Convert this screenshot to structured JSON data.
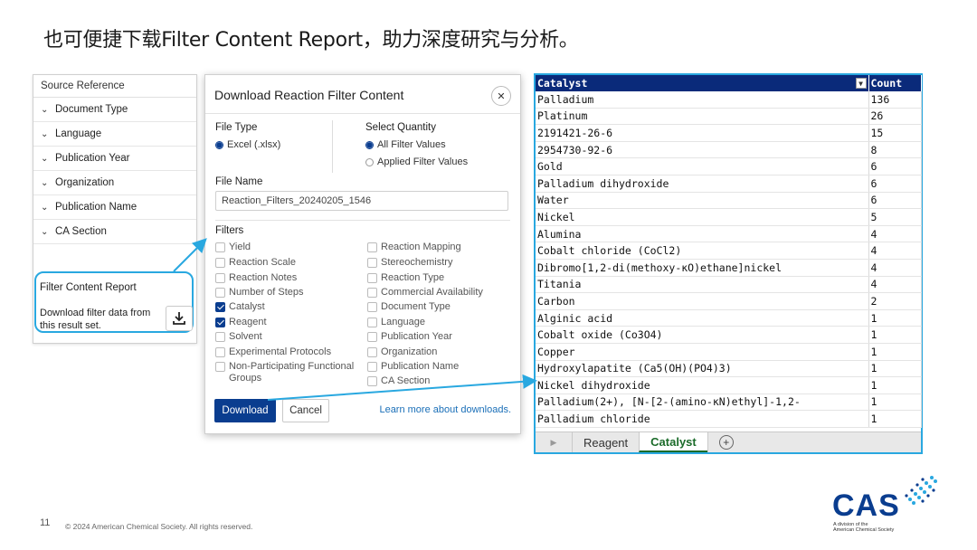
{
  "slide": {
    "title": "也可便捷下载Filter Content Report，助力深度研究与分析。",
    "page_number": "11",
    "copyright": "© 2024 American Chemical Society. All rights reserved.",
    "logo_text": "CAS",
    "logo_sub_1": "A division of the",
    "logo_sub_2": "American Chemical Society"
  },
  "sidebar": {
    "header": "Source Reference",
    "items": [
      {
        "label": "Document Type"
      },
      {
        "label": "Language"
      },
      {
        "label": "Publication Year"
      },
      {
        "label": "Organization"
      },
      {
        "label": "Publication Name"
      },
      {
        "label": "CA Section"
      }
    ],
    "report_title": "Filter Content Report",
    "report_desc": "Download filter data from this result set."
  },
  "dialog": {
    "title": "Download Reaction Filter Content",
    "file_type_label": "File Type",
    "file_type_option": "Excel (.xlsx)",
    "quantity_label": "Select Quantity",
    "quantity_all": "All Filter Values",
    "quantity_applied": "Applied Filter Values",
    "file_name_label": "File Name",
    "file_name_value": "Reaction_Filters_20240205_1546",
    "filters_label": "Filters",
    "filters_left": [
      {
        "label": "Yield",
        "checked": false
      },
      {
        "label": "Reaction Scale",
        "checked": false
      },
      {
        "label": "Reaction Notes",
        "checked": false
      },
      {
        "label": "Number of Steps",
        "checked": false
      },
      {
        "label": "Catalyst",
        "checked": true
      },
      {
        "label": "Reagent",
        "checked": true
      },
      {
        "label": "Solvent",
        "checked": false
      },
      {
        "label": "Experimental Protocols",
        "checked": false
      },
      {
        "label": "Non-Participating Functional Groups",
        "checked": false
      }
    ],
    "filters_right": [
      {
        "label": "Reaction Mapping",
        "checked": false
      },
      {
        "label": "Stereochemistry",
        "checked": false
      },
      {
        "label": "Reaction Type",
        "checked": false
      },
      {
        "label": "Commercial Availability",
        "checked": false
      },
      {
        "label": "Document Type",
        "checked": false
      },
      {
        "label": "Language",
        "checked": false
      },
      {
        "label": "Publication Year",
        "checked": false
      },
      {
        "label": "Organization",
        "checked": false
      },
      {
        "label": "Publication Name",
        "checked": false
      },
      {
        "label": "CA Section",
        "checked": false
      }
    ],
    "download_label": "Download",
    "cancel_label": "Cancel",
    "learn_more": "Learn more about downloads."
  },
  "spreadsheet": {
    "headers": [
      "Catalyst",
      "Count"
    ],
    "rows": [
      [
        "Palladium",
        "136"
      ],
      [
        "Platinum",
        "26"
      ],
      [
        "2191421-26-6",
        "15"
      ],
      [
        "2954730-92-6",
        "8"
      ],
      [
        "Gold",
        "6"
      ],
      [
        "Palladium dihydroxide",
        "6"
      ],
      [
        "Water",
        "6"
      ],
      [
        "Nickel",
        "5"
      ],
      [
        "Alumina",
        "4"
      ],
      [
        "Cobalt chloride (CoCl2)",
        "4"
      ],
      [
        "Dibromo[1,2-di(methoxy-κO)ethane]nickel",
        "4"
      ],
      [
        "Titania",
        "4"
      ],
      [
        "Carbon",
        "2"
      ],
      [
        "Alginic acid",
        "1"
      ],
      [
        "Cobalt oxide (Co3O4)",
        "1"
      ],
      [
        "Copper",
        "1"
      ],
      [
        "Hydroxylapatite (Ca5(OH)(PO4)3)",
        "1"
      ],
      [
        "Nickel dihydroxide",
        "1"
      ],
      [
        "Palladium(2+), [N-[2-(amino-κN)ethyl]-1,2-",
        "1"
      ],
      [
        "Palladium chloride",
        "1"
      ]
    ],
    "tabs": [
      "Reagent",
      "Catalyst"
    ],
    "active_tab": "Catalyst"
  },
  "colors": {
    "accent_blue": "#0a3d8f",
    "callout_cyan": "#29a8e0",
    "header_navy": "#0a2a7a",
    "active_tab_green": "#1b6b2a"
  }
}
